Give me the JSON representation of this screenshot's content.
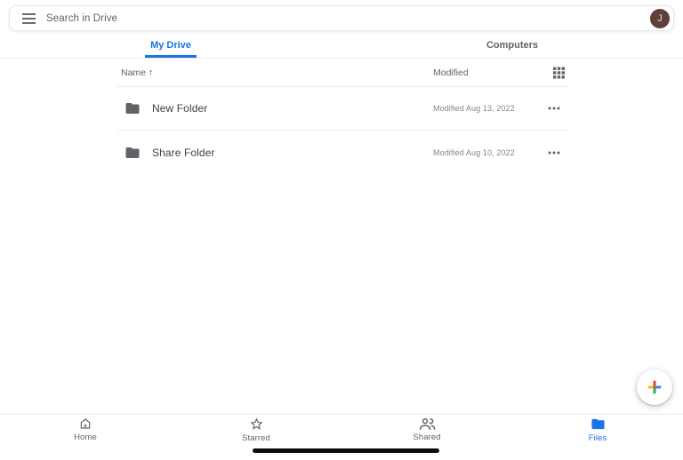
{
  "search_bar": {
    "placeholder": "Search in Drive",
    "avatar_letter": "J"
  },
  "tabs": [
    {
      "label": "My Drive",
      "active": true
    },
    {
      "label": "Computers",
      "active": false
    }
  ],
  "file_list": {
    "header": {
      "name_label": "Name",
      "sort_arrow": "↑",
      "modified_label": "Modified"
    },
    "rows": [
      {
        "name": "New Folder",
        "modified": "Modified Aug 13, 2022"
      },
      {
        "name": "Share Folder",
        "modified": "Modified Aug 10, 2022"
      }
    ]
  },
  "bottom_nav": [
    {
      "label": "Home",
      "active": false
    },
    {
      "label": "Starred",
      "active": false
    },
    {
      "label": "Shared",
      "active": false
    },
    {
      "label": "Files",
      "active": true
    }
  ],
  "icons": {
    "hamburger-menu-icon": "≡ three horizontal bars",
    "grid-view-icon": "3x3 grid of squares",
    "sort-arrow-up-icon": "↑",
    "folder-icon": "filled gray folder",
    "more-options-icon": "••• horizontal dots",
    "plus-icon": "multicolor google plus",
    "home-icon": "house outline with door",
    "star-icon": "star outline",
    "shared-icon": "two people outline",
    "files-icon": "filled blue folder"
  },
  "colors": {
    "accent_blue": "#1a73e8",
    "text_primary": "#3c4043",
    "text_secondary": "#5f6368",
    "text_muted": "#80868b",
    "divider": "#e8eaed",
    "avatar_bg": "#5d4037",
    "plus_red": "#ea4335",
    "plus_yellow": "#fbbc04",
    "plus_blue": "#4285f4",
    "plus_green": "#34a853",
    "home_indicator": "#0c0c0c"
  }
}
